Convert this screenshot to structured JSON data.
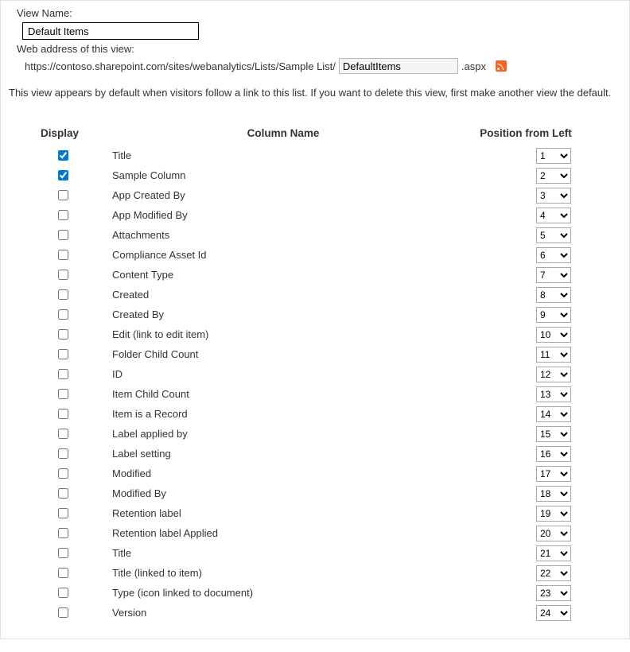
{
  "labels": {
    "viewName": "View Name:",
    "webAddress": "Web address of this view:",
    "urlPrefix": "https://contoso.sharepoint.com/sites/webanalytics/Lists/Sample List/",
    "urlSuffix": ".aspx"
  },
  "values": {
    "viewName": "Default Items",
    "urlSegment": "DefaultItems"
  },
  "infoText": "This view appears by default when visitors follow a link to this list. If you want to delete this view, first make another view the default.",
  "headers": {
    "display": "Display",
    "columnName": "Column Name",
    "position": "Position from Left"
  },
  "columns": [
    {
      "display": true,
      "name": "Title",
      "position": "1"
    },
    {
      "display": true,
      "name": "Sample Column",
      "position": "2"
    },
    {
      "display": false,
      "name": "App Created By",
      "position": "3"
    },
    {
      "display": false,
      "name": "App Modified By",
      "position": "4"
    },
    {
      "display": false,
      "name": "Attachments",
      "position": "5"
    },
    {
      "display": false,
      "name": "Compliance Asset Id",
      "position": "6"
    },
    {
      "display": false,
      "name": "Content Type",
      "position": "7"
    },
    {
      "display": false,
      "name": "Created",
      "position": "8"
    },
    {
      "display": false,
      "name": "Created By",
      "position": "9"
    },
    {
      "display": false,
      "name": "Edit (link to edit item)",
      "position": "10"
    },
    {
      "display": false,
      "name": "Folder Child Count",
      "position": "11"
    },
    {
      "display": false,
      "name": "ID",
      "position": "12"
    },
    {
      "display": false,
      "name": "Item Child Count",
      "position": "13"
    },
    {
      "display": false,
      "name": "Item is a Record",
      "position": "14"
    },
    {
      "display": false,
      "name": "Label applied by",
      "position": "15"
    },
    {
      "display": false,
      "name": "Label setting",
      "position": "16"
    },
    {
      "display": false,
      "name": "Modified",
      "position": "17"
    },
    {
      "display": false,
      "name": "Modified By",
      "position": "18"
    },
    {
      "display": false,
      "name": "Retention label",
      "position": "19"
    },
    {
      "display": false,
      "name": "Retention label Applied",
      "position": "20"
    },
    {
      "display": false,
      "name": "Title",
      "position": "21"
    },
    {
      "display": false,
      "name": "Title (linked to item)",
      "position": "22"
    },
    {
      "display": false,
      "name": "Type (icon linked to document)",
      "position": "23"
    },
    {
      "display": false,
      "name": "Version",
      "position": "24"
    }
  ]
}
